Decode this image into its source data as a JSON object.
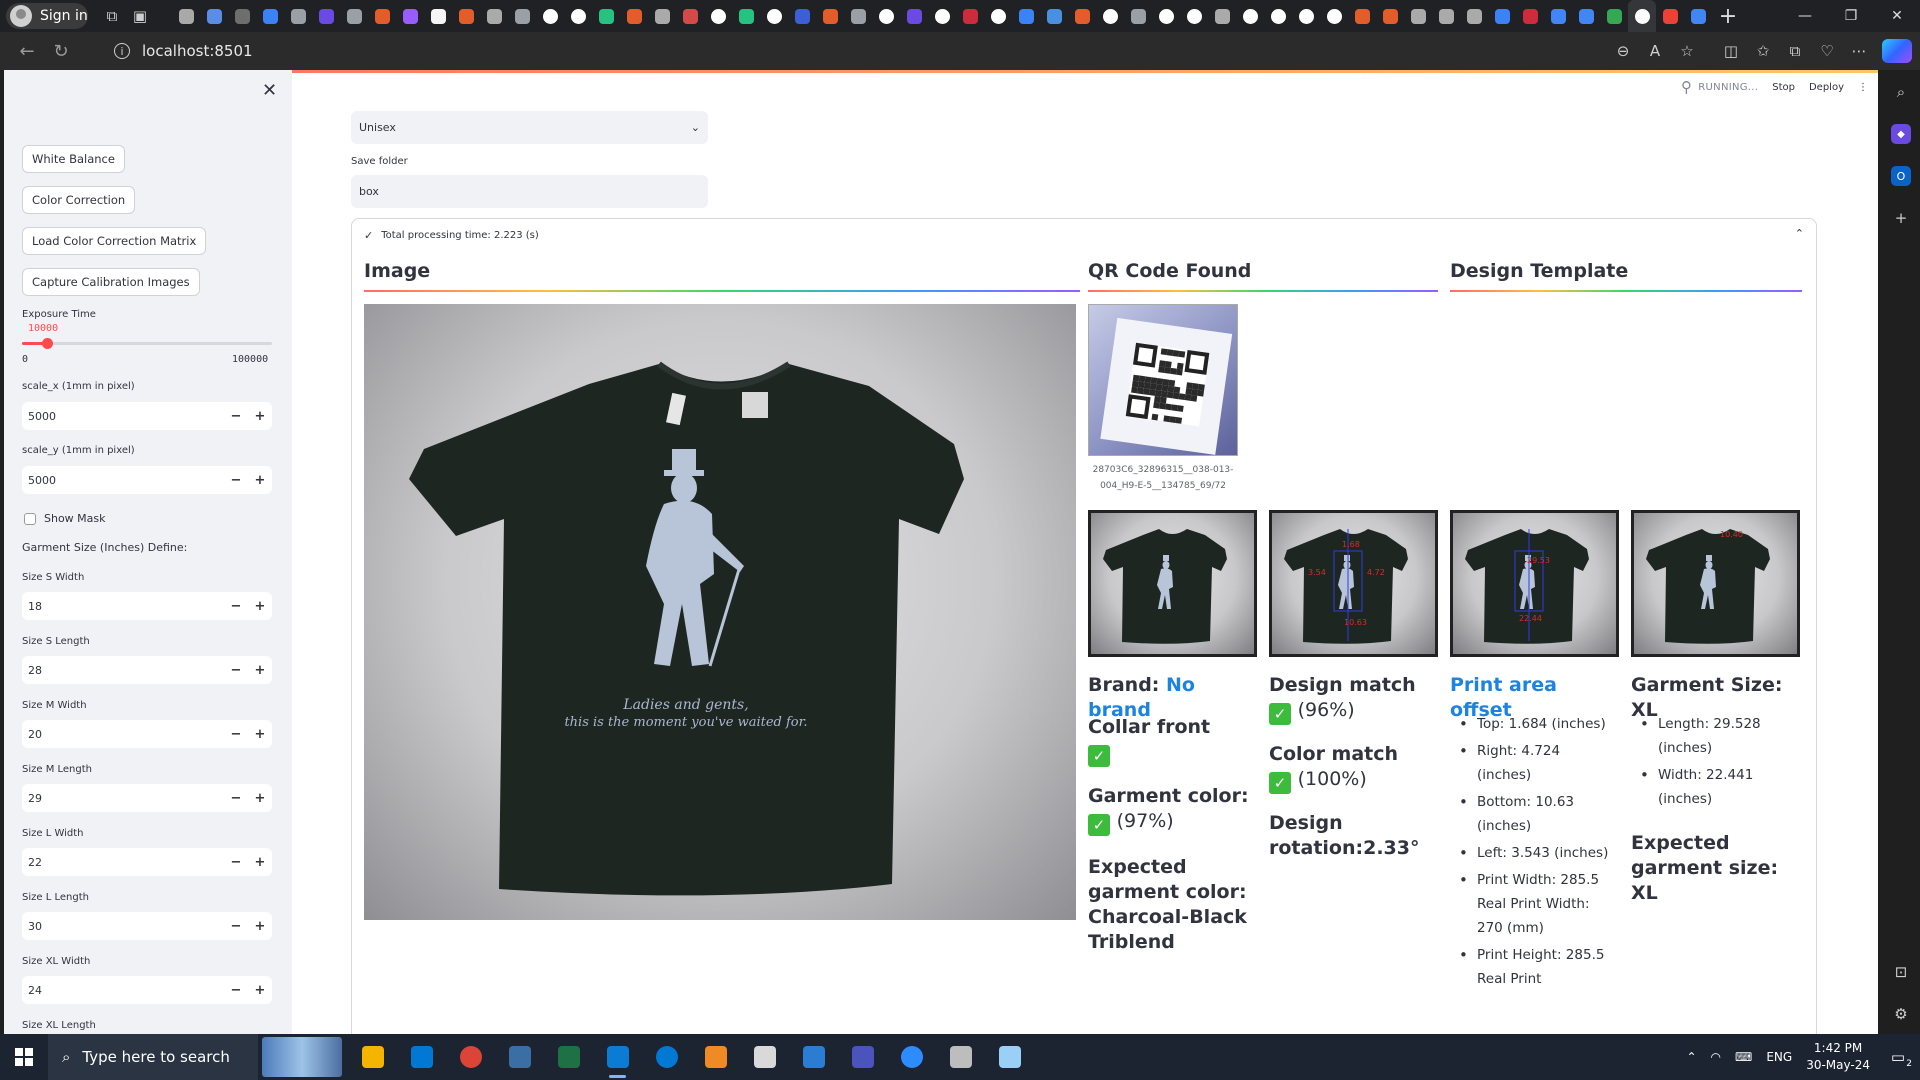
{
  "browser": {
    "profile_label": "Sign in",
    "url": "localhost:8501",
    "tab_favicon_colors": [
      "#a9a9a9",
      "#5a8ee6",
      "#6e6e6e",
      "#3b82f6",
      "#9aa0a6",
      "#6a4ae0",
      "#9aa0a6",
      "#e35d2b",
      "#9a5dfd",
      "#f5f5f5",
      "#e35d2b",
      "#aaaaaa",
      "#9aa0a6",
      "#ffffff",
      "#ffffff",
      "#26c281",
      "#e35d2b",
      "#aaaaaa",
      "#d34a48",
      "#ffffff",
      "#26c281",
      "#ffffff",
      "#3b5fd6",
      "#e35d2b",
      "#9aa0a6",
      "#ffffff",
      "#6a4ae0",
      "#ffffff",
      "#cc2d3c",
      "#ffffff",
      "#3b82f6",
      "#4a90e2",
      "#e35d2b",
      "#ffffff",
      "#9aa0a6",
      "#ffffff",
      "#ffffff",
      "#aaaaaa",
      "#ffffff",
      "#ffffff",
      "#ffffff",
      "#ffffff",
      "#e35d2b",
      "#e35d2b",
      "#aaaaaa",
      "#aaaaaa",
      "#aaaaaa",
      "#3b82f6",
      "#cc2d3c",
      "#4285f4",
      "#4285f4",
      "#34a853",
      "#ffffff",
      "#ea4335",
      "#4285f4"
    ]
  },
  "sidebar": {
    "buttons": [
      "White Balance",
      "Color Correction",
      "Load Color Correction Matrix",
      "Capture Calibration Images"
    ],
    "exposure": {
      "label": "Exposure Time",
      "value": "10000",
      "min": "0",
      "max": "100000",
      "fraction": 0.1
    },
    "scale_x": {
      "label": "scale_x (1mm in pixel)",
      "value": "5000"
    },
    "scale_y": {
      "label": "scale_y (1mm in pixel)",
      "value": "5000"
    },
    "show_mask": "Show Mask",
    "garment_size_heading": "Garment Size (Inches) Define:",
    "sizes": [
      {
        "label": "Size S Width",
        "value": "18"
      },
      {
        "label": "Size S Length",
        "value": "28"
      },
      {
        "label": "Size M Width",
        "value": "20"
      },
      {
        "label": "Size M Length",
        "value": "29"
      },
      {
        "label": "Size L Width",
        "value": "22"
      },
      {
        "label": "Size L Length",
        "value": "30"
      },
      {
        "label": "Size XL Width",
        "value": "24"
      },
      {
        "label": "Size XL Length",
        "value": ""
      }
    ],
    "minus": "−",
    "plus": "+"
  },
  "header": {
    "running": "RUNNING...",
    "stop": "Stop",
    "deploy": "Deploy"
  },
  "main": {
    "gender_select": "Unisex",
    "save_folder_label": "Save folder",
    "save_folder_value": "box",
    "processing_time": "Total processing time: 2.223 (s)",
    "col_image": "Image",
    "col_qr": "QR Code Found",
    "col_design": "Design Template",
    "qr_caption": "28703C6_32896315__038-013-004_H9-E-5__134785_69/72",
    "shirt_text_1": "Ladies and gents,",
    "shirt_text_2": "this is the moment you've waited for.",
    "brand_label": "Brand:",
    "brand_value": "No brand",
    "collar": "Collar front",
    "garment_color_label": "Garment color:",
    "garment_color_pct": "(97%)",
    "expected_color": "Expected garment color: Charcoal-Black Triblend",
    "design_match_label": "Design match",
    "design_match_pct": "(96%)",
    "color_match_label": "Color match",
    "color_match_pct": "(100%)",
    "design_rotation": "Design rotation:2.33°",
    "print_offset_title": "Print area offset",
    "offsets": [
      "Top: 1.684 (inches)",
      "Right: 4.724 (inches)",
      "Bottom: 10.63 (inches)",
      "Left: 3.543 (inches)",
      "Print Width: 285.5 Real Print Width: 270 (mm)",
      "Print Height: 285.5 Real Print"
    ],
    "garment_size_title": "Garment Size: XL",
    "size_items": [
      "Length: 29.528 (inches)",
      "Width: 22.441 (inches)"
    ],
    "expected_size": "Expected garment size: XL",
    "thumb2_labels": [
      "1.68",
      "3.54",
      "4.72",
      "10.63"
    ],
    "thumb3_labels": [
      "29.53",
      "22.44"
    ],
    "thumb4_label": "10.40"
  },
  "taskbar": {
    "search_placeholder": "Type here to search",
    "app_colors": [
      "#f4b400",
      "#0078d4",
      "#db4437",
      "#3a6ea5",
      "#1e7145",
      "#0c7bd4",
      "#0078d4",
      "#f08a24",
      "#d9d9d9",
      "#2b7cd3",
      "#4b53bc",
      "#2d8cff",
      "#bdbdbd",
      "#9ad0f5"
    ],
    "lang": "ENG",
    "time": "1:42 PM",
    "date": "30-May-24",
    "notif_count": "2"
  },
  "accent_colors": {
    "streamlit_red": "#ff4b4b",
    "link_blue": "#1c83e1",
    "check_green": "#3dbb3d"
  }
}
